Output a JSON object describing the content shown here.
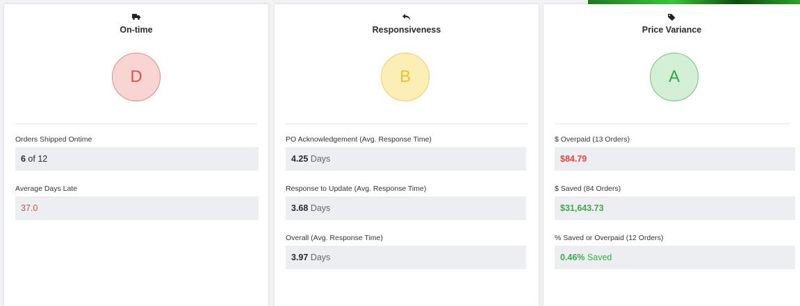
{
  "cards": [
    {
      "title": "On-time",
      "icon": "truck-icon",
      "grade": "D",
      "grade_color": "#e0524a",
      "metrics": [
        {
          "label": "Orders Shipped Ontime",
          "value": "6",
          "unit": " of 12"
        },
        {
          "label": "Average Days Late",
          "value": "37.0"
        }
      ]
    },
    {
      "title": "Responsiveness",
      "icon": "reply-icon",
      "grade": "B",
      "grade_color": "#e6c22c",
      "metrics": [
        {
          "label": "PO Acknowledgement (Avg. Response Time)",
          "value": "4.25",
          "unit": " Days"
        },
        {
          "label": "Response to Update (Avg. Response Time)",
          "value": "3.68",
          "unit": " Days"
        },
        {
          "label": "Overall (Avg. Response Time)",
          "value": "3.97",
          "unit": " Days"
        }
      ]
    },
    {
      "title": "Price Variance",
      "icon": "tag-icon",
      "grade": "A",
      "grade_color": "#35a447",
      "metrics": [
        {
          "label": "$ Overpaid (13 Orders)",
          "value": "$84.79"
        },
        {
          "label": "$ Saved (84 Orders)",
          "value": "$31,643.73"
        },
        {
          "label": "% Saved or Overpaid (12 Orders)",
          "value": "0.46%",
          "unit": " Saved"
        }
      ]
    }
  ]
}
